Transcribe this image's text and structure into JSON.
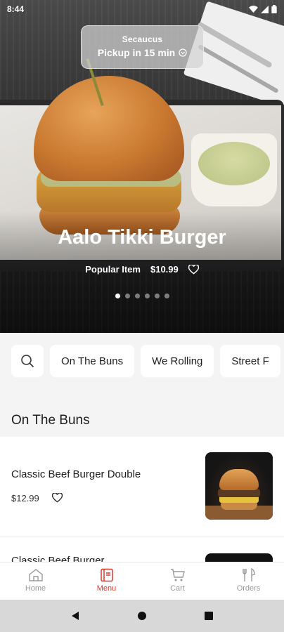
{
  "status_bar": {
    "time": "8:44"
  },
  "location": {
    "city": "Secaucus",
    "pickup": "Pickup in 15 min"
  },
  "hero": {
    "title": "Aalo Tikki Burger",
    "tag": "Popular Item",
    "price": "$10.99",
    "dots_total": 6,
    "dots_active_index": 0
  },
  "categories": [
    "On The Buns",
    "We Rolling",
    "Street F"
  ],
  "section": {
    "title": "On The Buns"
  },
  "items": [
    {
      "name": "Classic Beef Burger Double",
      "price": "$12.99"
    },
    {
      "name": "Classic Beef Burger"
    }
  ],
  "bottom_nav": [
    {
      "label": "Home",
      "icon": "home-icon"
    },
    {
      "label": "Menu",
      "icon": "menu-icon",
      "active": true
    },
    {
      "label": "Cart",
      "icon": "cart-icon"
    },
    {
      "label": "Orders",
      "icon": "orders-icon"
    }
  ],
  "colors": {
    "accent": "#e0352c",
    "chip_bg": "#f4f4f4"
  }
}
